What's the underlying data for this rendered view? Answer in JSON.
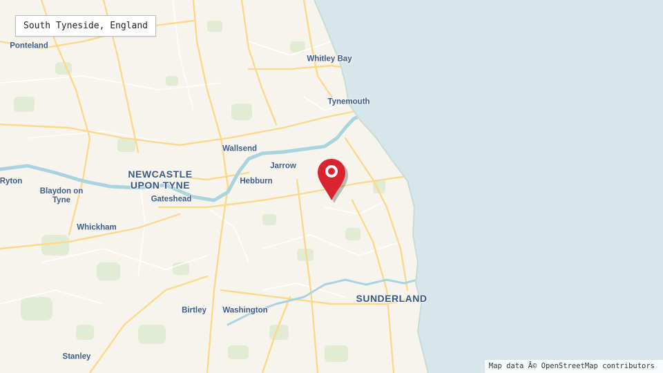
{
  "map": {
    "location_label": "South Tyneside, England",
    "attribution": "Map data Â© OpenStreetMap contributors",
    "marker_icon": "location-pin-icon",
    "colors": {
      "sea": "#d6e6ea",
      "land": "#f7f4ee",
      "river": "#a9d3dd",
      "major_road": "#fbd88a",
      "minor_road": "#ffffff",
      "park": "#e2ecd4",
      "label": "#3d5b86",
      "marker": "#d9232e"
    },
    "places": [
      {
        "id": "ponteland",
        "name": "Ponteland"
      },
      {
        "id": "whitley-bay",
        "name": "Whitley Bay"
      },
      {
        "id": "tynemouth",
        "name": "Tynemouth"
      },
      {
        "id": "wallsend",
        "name": "Wallsend"
      },
      {
        "id": "jarrow",
        "name": "Jarrow"
      },
      {
        "id": "hebburn",
        "name": "Hebburn"
      },
      {
        "id": "newcastle",
        "name": "NEWCASTLE UPON TYNE"
      },
      {
        "id": "ryton",
        "name": "Ryton"
      },
      {
        "id": "blaydon",
        "name": "Blaydon on Tyne"
      },
      {
        "id": "gateshead",
        "name": "Gateshead"
      },
      {
        "id": "whickham",
        "name": "Whickham"
      },
      {
        "id": "sunderland",
        "name": "SUNDERLAND"
      },
      {
        "id": "birtley",
        "name": "Birtley"
      },
      {
        "id": "washington",
        "name": "Washington"
      },
      {
        "id": "stanley",
        "name": "Stanley"
      }
    ]
  }
}
